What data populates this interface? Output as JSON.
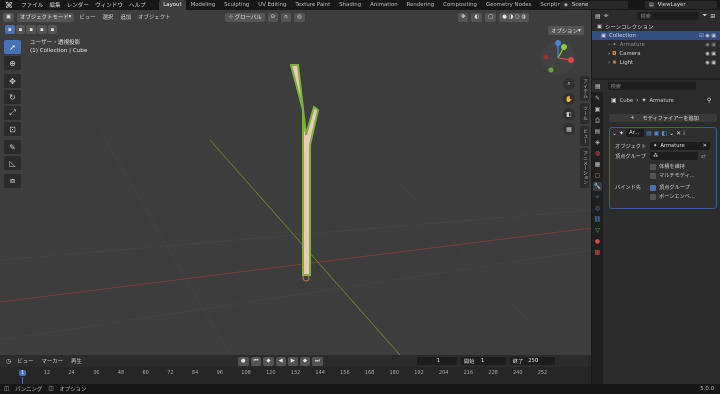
{
  "topbar": {
    "menus": [
      "ファイル",
      "編集",
      "レンダー",
      "ウィンドウ",
      "ヘルプ"
    ],
    "workspaces": [
      "Layout",
      "Modeling",
      "Sculpting",
      "UV Editing",
      "Texture Paint",
      "Shading",
      "Animation",
      "Rendering",
      "Compositing",
      "Geometry Nodes",
      "Scripting",
      "+"
    ],
    "active_workspace": "Layout",
    "scene": "Scene",
    "view_layer": "ViewLayer"
  },
  "viewport": {
    "mode": "オブジェクトモード",
    "menus": [
      "ビュー",
      "選択",
      "追加",
      "オブジェクト"
    ],
    "transform": "グローバル",
    "options_label": "オプション",
    "view_name": "ユーザー・透視投影",
    "collection_line": "(1) Collection | Cube",
    "side_tabs": [
      "アイテム",
      "ツール",
      "ビュー",
      "アニメーション"
    ]
  },
  "timeline": {
    "menus": [
      "ビュー",
      "マーカー",
      "再生"
    ],
    "current_frame": "1",
    "start_label": "開始",
    "start": "1",
    "end_label": "終了",
    "end": "250",
    "ticks": [
      "1",
      "12",
      "24",
      "36",
      "48",
      "60",
      "72",
      "84",
      "96",
      "108",
      "120",
      "132",
      "144",
      "156",
      "168",
      "180",
      "192",
      "204",
      "216",
      "228",
      "240",
      "252"
    ]
  },
  "status": {
    "items": [
      "パンニング",
      "オプション"
    ],
    "version": "5.0.0"
  },
  "outliner": {
    "search_placeholder": "検索",
    "rows": [
      {
        "label": "シーンコレクション",
        "indent": 0
      },
      {
        "label": "Collection",
        "indent": 1
      },
      {
        "label": "Armature",
        "indent": 2
      },
      {
        "label": "Camera",
        "indent": 2
      },
      {
        "label": "Light",
        "indent": 2
      }
    ]
  },
  "properties": {
    "search_placeholder": "検索",
    "breadcrumb_object": "Cube",
    "breadcrumb_modifier": "Armature",
    "add_modifier": "モディファイアーを追加",
    "modifier_name": "Ar...",
    "object_label": "オブジェクト",
    "object_value": "Armature",
    "vgroup_label": "頂点グループ",
    "preserve_volume": "体積を維持",
    "multi_modifier": "マルチモディ...",
    "bind_to_label": "バインド先",
    "bind_vgroups": "頂点グループ",
    "bind_envelopes": "ボーンエンベ..."
  },
  "colors": {
    "accent": "#4772b3",
    "viewport_bg": "#3d3d3d",
    "mesh": "#e8c8b8",
    "bone_outline": "#7ab83a"
  }
}
